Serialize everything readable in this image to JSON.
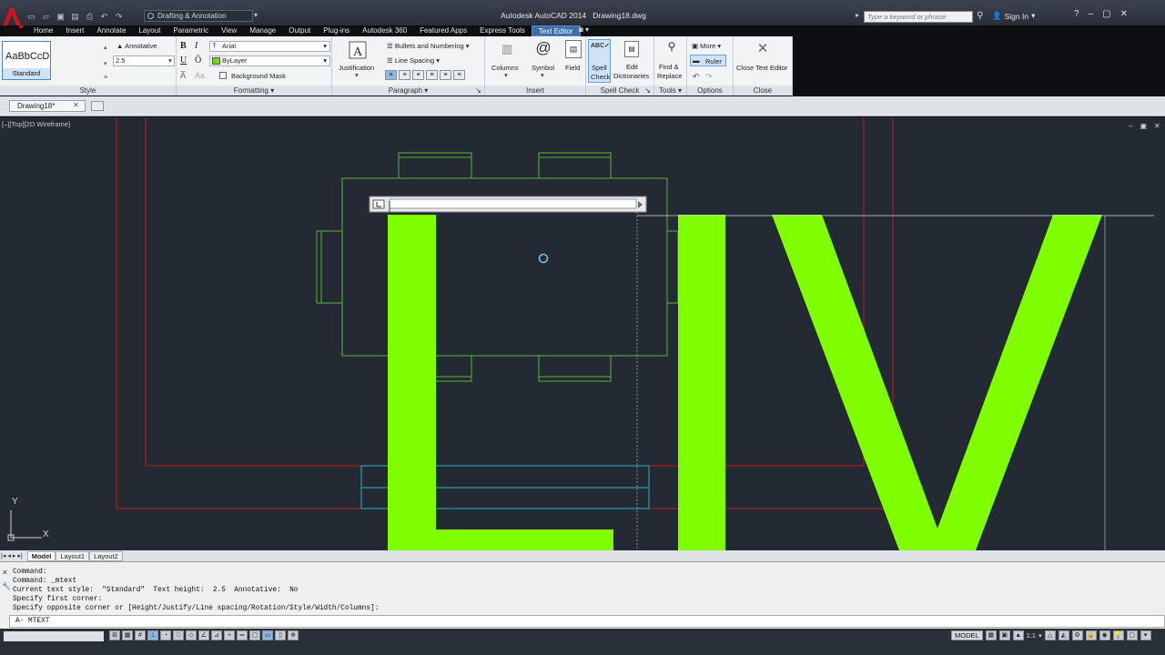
{
  "titlebar": {
    "app_title": "Autodesk AutoCAD 2014",
    "file_title": "Drawing18.dwg",
    "workspace": "Drafting & Annotation",
    "search_placeholder": "Type a keyword or phrase",
    "sign_in": "Sign In"
  },
  "menu": {
    "tabs": [
      "Home",
      "Insert",
      "Annotate",
      "Layout",
      "Parametric",
      "View",
      "Manage",
      "Output",
      "Plug-ins",
      "Autodesk 360",
      "Featured Apps",
      "Express Tools",
      "Text Editor"
    ],
    "active_tab": "Text Editor"
  },
  "ribbon": {
    "style": {
      "preview_text": "AaBbCcD",
      "style_name": "Standard",
      "annotative_label": "Annotative",
      "text_height": "2.5",
      "panel_label": "Style"
    },
    "formatting": {
      "bold": "B",
      "italic": "I",
      "underline": "U",
      "overline": "Ō",
      "font": "Arial",
      "color": "ByLayer",
      "color_hex": "#6fd81b",
      "background_mask": "Background Mask",
      "panel_label": "Formatting"
    },
    "paragraph": {
      "justification": "Justification",
      "bullets": "Bullets and Numbering",
      "line_spacing": "Line Spacing",
      "panel_label": "Paragraph"
    },
    "insert": {
      "columns": "Columns",
      "symbol": "Symbol",
      "field": "Field",
      "panel_label": "Insert"
    },
    "spell_check": {
      "spell_check_line1": "Spell",
      "spell_check_line2": "Check",
      "edit_dict_line1": "Edit",
      "edit_dict_line2": "Dictionaries",
      "panel_label": "Spell Check"
    },
    "tools": {
      "find_line1": "Find &",
      "find_line2": "Replace",
      "panel_label": "Tools"
    },
    "options": {
      "more": "More",
      "ruler": "Ruler",
      "panel_label": "Options"
    },
    "close": {
      "close_text_editor": "Close Text Editor",
      "panel_label": "Close"
    }
  },
  "file_tabs": {
    "active": "Drawing18*"
  },
  "viewport": {
    "label": "[–][Top][2D Wireframe]",
    "big_text": "LIV",
    "text_color": "#7fff00",
    "ucs_y": "Y",
    "ucs_x": "X"
  },
  "layout_tabs": [
    "Model",
    "Layout1",
    "Layout2"
  ],
  "command": {
    "log": [
      "Command:",
      "Command: _mtext",
      "Current text style:  \"Standard\"  Text height:  2.5  Annotative:  No",
      "Specify first corner:",
      "Specify opposite corner or [Height/Justify/Line spacing/Rotation/Style/Width/Columns]:"
    ],
    "prompt": "MTEXT"
  },
  "statusbar": {
    "model": "MODEL",
    "scale": "1:1"
  }
}
